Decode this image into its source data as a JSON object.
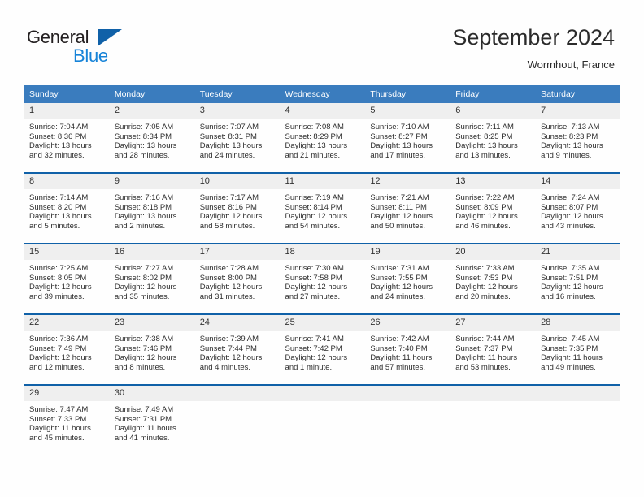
{
  "brand": {
    "name_part1": "General",
    "name_part2": "Blue",
    "logo_icon": "triangle-logo-icon"
  },
  "header": {
    "title": "September 2024",
    "subtitle": "Wormhout, France"
  },
  "colors": {
    "header_blue": "#3a7cbe",
    "separator_blue": "#1061a8",
    "daynum_band": "#efefef",
    "brand_blue": "#1683d8",
    "text": "#2c2c2c"
  },
  "calendar": {
    "weekday_headers": [
      "Sunday",
      "Monday",
      "Tuesday",
      "Wednesday",
      "Thursday",
      "Friday",
      "Saturday"
    ],
    "weeks": [
      [
        {
          "day": "1",
          "sunrise": "Sunrise: 7:04 AM",
          "sunset": "Sunset: 8:36 PM",
          "daylight1": "Daylight: 13 hours",
          "daylight2": "and 32 minutes."
        },
        {
          "day": "2",
          "sunrise": "Sunrise: 7:05 AM",
          "sunset": "Sunset: 8:34 PM",
          "daylight1": "Daylight: 13 hours",
          "daylight2": "and 28 minutes."
        },
        {
          "day": "3",
          "sunrise": "Sunrise: 7:07 AM",
          "sunset": "Sunset: 8:31 PM",
          "daylight1": "Daylight: 13 hours",
          "daylight2": "and 24 minutes."
        },
        {
          "day": "4",
          "sunrise": "Sunrise: 7:08 AM",
          "sunset": "Sunset: 8:29 PM",
          "daylight1": "Daylight: 13 hours",
          "daylight2": "and 21 minutes."
        },
        {
          "day": "5",
          "sunrise": "Sunrise: 7:10 AM",
          "sunset": "Sunset: 8:27 PM",
          "daylight1": "Daylight: 13 hours",
          "daylight2": "and 17 minutes."
        },
        {
          "day": "6",
          "sunrise": "Sunrise: 7:11 AM",
          "sunset": "Sunset: 8:25 PM",
          "daylight1": "Daylight: 13 hours",
          "daylight2": "and 13 minutes."
        },
        {
          "day": "7",
          "sunrise": "Sunrise: 7:13 AM",
          "sunset": "Sunset: 8:23 PM",
          "daylight1": "Daylight: 13 hours",
          "daylight2": "and 9 minutes."
        }
      ],
      [
        {
          "day": "8",
          "sunrise": "Sunrise: 7:14 AM",
          "sunset": "Sunset: 8:20 PM",
          "daylight1": "Daylight: 13 hours",
          "daylight2": "and 5 minutes."
        },
        {
          "day": "9",
          "sunrise": "Sunrise: 7:16 AM",
          "sunset": "Sunset: 8:18 PM",
          "daylight1": "Daylight: 13 hours",
          "daylight2": "and 2 minutes."
        },
        {
          "day": "10",
          "sunrise": "Sunrise: 7:17 AM",
          "sunset": "Sunset: 8:16 PM",
          "daylight1": "Daylight: 12 hours",
          "daylight2": "and 58 minutes."
        },
        {
          "day": "11",
          "sunrise": "Sunrise: 7:19 AM",
          "sunset": "Sunset: 8:14 PM",
          "daylight1": "Daylight: 12 hours",
          "daylight2": "and 54 minutes."
        },
        {
          "day": "12",
          "sunrise": "Sunrise: 7:21 AM",
          "sunset": "Sunset: 8:11 PM",
          "daylight1": "Daylight: 12 hours",
          "daylight2": "and 50 minutes."
        },
        {
          "day": "13",
          "sunrise": "Sunrise: 7:22 AM",
          "sunset": "Sunset: 8:09 PM",
          "daylight1": "Daylight: 12 hours",
          "daylight2": "and 46 minutes."
        },
        {
          "day": "14",
          "sunrise": "Sunrise: 7:24 AM",
          "sunset": "Sunset: 8:07 PM",
          "daylight1": "Daylight: 12 hours",
          "daylight2": "and 43 minutes."
        }
      ],
      [
        {
          "day": "15",
          "sunrise": "Sunrise: 7:25 AM",
          "sunset": "Sunset: 8:05 PM",
          "daylight1": "Daylight: 12 hours",
          "daylight2": "and 39 minutes."
        },
        {
          "day": "16",
          "sunrise": "Sunrise: 7:27 AM",
          "sunset": "Sunset: 8:02 PM",
          "daylight1": "Daylight: 12 hours",
          "daylight2": "and 35 minutes."
        },
        {
          "day": "17",
          "sunrise": "Sunrise: 7:28 AM",
          "sunset": "Sunset: 8:00 PM",
          "daylight1": "Daylight: 12 hours",
          "daylight2": "and 31 minutes."
        },
        {
          "day": "18",
          "sunrise": "Sunrise: 7:30 AM",
          "sunset": "Sunset: 7:58 PM",
          "daylight1": "Daylight: 12 hours",
          "daylight2": "and 27 minutes."
        },
        {
          "day": "19",
          "sunrise": "Sunrise: 7:31 AM",
          "sunset": "Sunset: 7:55 PM",
          "daylight1": "Daylight: 12 hours",
          "daylight2": "and 24 minutes."
        },
        {
          "day": "20",
          "sunrise": "Sunrise: 7:33 AM",
          "sunset": "Sunset: 7:53 PM",
          "daylight1": "Daylight: 12 hours",
          "daylight2": "and 20 minutes."
        },
        {
          "day": "21",
          "sunrise": "Sunrise: 7:35 AM",
          "sunset": "Sunset: 7:51 PM",
          "daylight1": "Daylight: 12 hours",
          "daylight2": "and 16 minutes."
        }
      ],
      [
        {
          "day": "22",
          "sunrise": "Sunrise: 7:36 AM",
          "sunset": "Sunset: 7:49 PM",
          "daylight1": "Daylight: 12 hours",
          "daylight2": "and 12 minutes."
        },
        {
          "day": "23",
          "sunrise": "Sunrise: 7:38 AM",
          "sunset": "Sunset: 7:46 PM",
          "daylight1": "Daylight: 12 hours",
          "daylight2": "and 8 minutes."
        },
        {
          "day": "24",
          "sunrise": "Sunrise: 7:39 AM",
          "sunset": "Sunset: 7:44 PM",
          "daylight1": "Daylight: 12 hours",
          "daylight2": "and 4 minutes."
        },
        {
          "day": "25",
          "sunrise": "Sunrise: 7:41 AM",
          "sunset": "Sunset: 7:42 PM",
          "daylight1": "Daylight: 12 hours",
          "daylight2": "and 1 minute."
        },
        {
          "day": "26",
          "sunrise": "Sunrise: 7:42 AM",
          "sunset": "Sunset: 7:40 PM",
          "daylight1": "Daylight: 11 hours",
          "daylight2": "and 57 minutes."
        },
        {
          "day": "27",
          "sunrise": "Sunrise: 7:44 AM",
          "sunset": "Sunset: 7:37 PM",
          "daylight1": "Daylight: 11 hours",
          "daylight2": "and 53 minutes."
        },
        {
          "day": "28",
          "sunrise": "Sunrise: 7:45 AM",
          "sunset": "Sunset: 7:35 PM",
          "daylight1": "Daylight: 11 hours",
          "daylight2": "and 49 minutes."
        }
      ],
      [
        {
          "day": "29",
          "sunrise": "Sunrise: 7:47 AM",
          "sunset": "Sunset: 7:33 PM",
          "daylight1": "Daylight: 11 hours",
          "daylight2": "and 45 minutes."
        },
        {
          "day": "30",
          "sunrise": "Sunrise: 7:49 AM",
          "sunset": "Sunset: 7:31 PM",
          "daylight1": "Daylight: 11 hours",
          "daylight2": "and 41 minutes."
        },
        {
          "day": "",
          "sunrise": "",
          "sunset": "",
          "daylight1": "",
          "daylight2": ""
        },
        {
          "day": "",
          "sunrise": "",
          "sunset": "",
          "daylight1": "",
          "daylight2": ""
        },
        {
          "day": "",
          "sunrise": "",
          "sunset": "",
          "daylight1": "",
          "daylight2": ""
        },
        {
          "day": "",
          "sunrise": "",
          "sunset": "",
          "daylight1": "",
          "daylight2": ""
        },
        {
          "day": "",
          "sunrise": "",
          "sunset": "",
          "daylight1": "",
          "daylight2": ""
        }
      ]
    ]
  }
}
